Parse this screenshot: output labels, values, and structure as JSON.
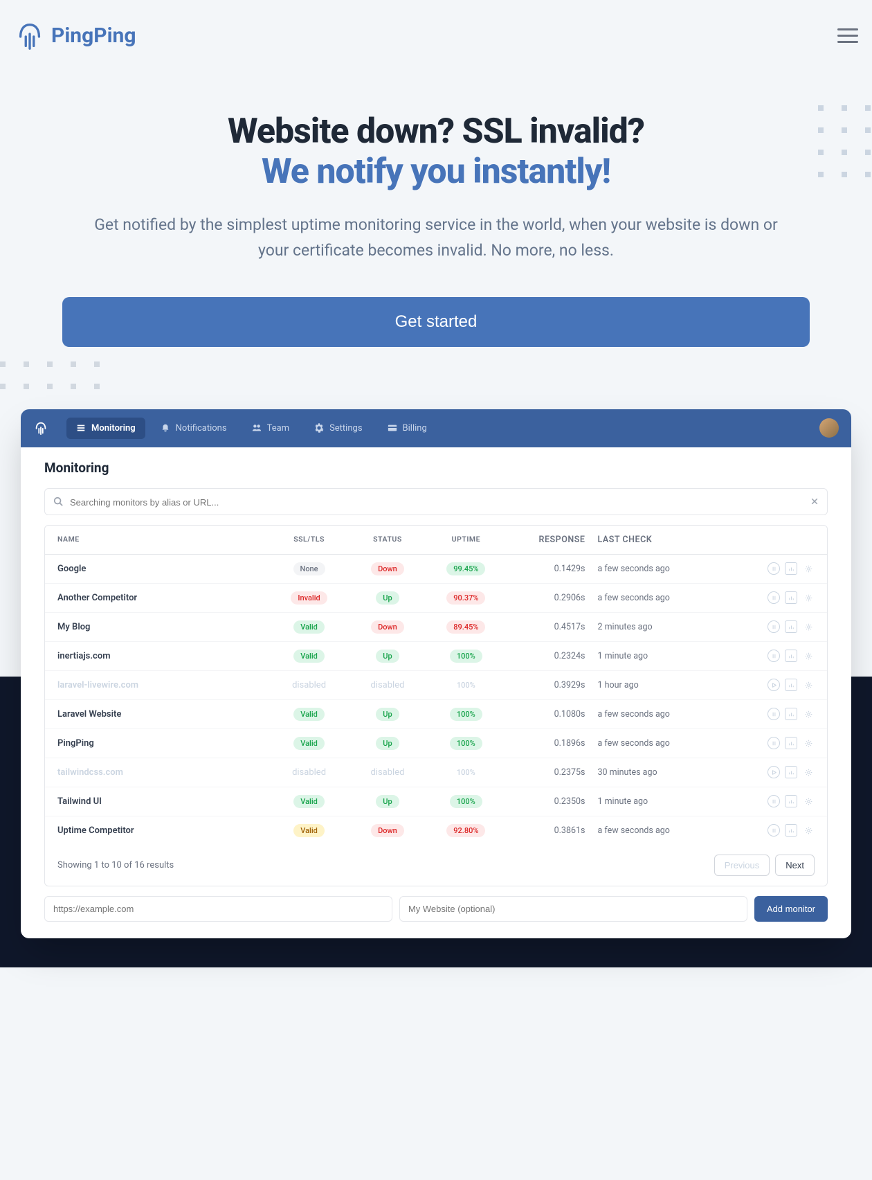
{
  "brand": "PingPing",
  "hero": {
    "line1": "Website down? SSL invalid?",
    "line2": "We notify you instantly!",
    "sub": "Get notified by the simplest uptime monitoring service in the world, when your website is down or your certificate becomes invalid. No more, no less.",
    "cta": "Get started"
  },
  "nav": {
    "monitoring": "Monitoring",
    "notifications": "Notifications",
    "team": "Team",
    "settings": "Settings",
    "billing": "Billing"
  },
  "app": {
    "title": "Monitoring",
    "search_placeholder": "Searching monitors by alias or URL...",
    "headers": {
      "name": "NAME",
      "ssl": "SSL/TLS",
      "status": "STATUS",
      "uptime": "UPTIME",
      "response": "RESPONSE",
      "last": "LAST CHECK"
    },
    "rows": [
      {
        "name": "Google",
        "ssl": "None",
        "ssl_c": "gray",
        "status": "Down",
        "status_c": "red",
        "uptime": "99.45%",
        "uptime_c": "green",
        "response": "0.1429s",
        "last": "a few seconds ago",
        "disabled": false,
        "paused": true
      },
      {
        "name": "Another Competitor",
        "ssl": "Invalid",
        "ssl_c": "red",
        "status": "Up",
        "status_c": "green",
        "uptime": "90.37%",
        "uptime_c": "red",
        "response": "0.2906s",
        "last": "a few seconds ago",
        "disabled": false,
        "paused": true
      },
      {
        "name": "My Blog",
        "ssl": "Valid",
        "ssl_c": "green",
        "status": "Down",
        "status_c": "red",
        "uptime": "89.45%",
        "uptime_c": "red",
        "response": "0.4517s",
        "last": "2 minutes ago",
        "disabled": false,
        "paused": true
      },
      {
        "name": "inertiajs.com",
        "ssl": "Valid",
        "ssl_c": "green",
        "status": "Up",
        "status_c": "green",
        "uptime": "100%",
        "uptime_c": "green",
        "response": "0.2324s",
        "last": "1 minute ago",
        "disabled": false,
        "paused": true
      },
      {
        "name": "laravel-livewire.com",
        "ssl": "disabled",
        "ssl_c": "",
        "status": "disabled",
        "status_c": "",
        "uptime": "100%",
        "uptime_c": "green",
        "response": "0.3929s",
        "last": "1 hour ago",
        "disabled": true,
        "paused": false
      },
      {
        "name": "Laravel Website",
        "ssl": "Valid",
        "ssl_c": "green",
        "status": "Up",
        "status_c": "green",
        "uptime": "100%",
        "uptime_c": "green",
        "response": "0.1080s",
        "last": "a few seconds ago",
        "disabled": false,
        "paused": true
      },
      {
        "name": "PingPing",
        "ssl": "Valid",
        "ssl_c": "green",
        "status": "Up",
        "status_c": "green",
        "uptime": "100%",
        "uptime_c": "green",
        "response": "0.1896s",
        "last": "a few seconds ago",
        "disabled": false,
        "paused": true
      },
      {
        "name": "tailwindcss.com",
        "ssl": "disabled",
        "ssl_c": "",
        "status": "disabled",
        "status_c": "",
        "uptime": "100%",
        "uptime_c": "green",
        "response": "0.2375s",
        "last": "30 minutes ago",
        "disabled": true,
        "paused": false
      },
      {
        "name": "Tailwind UI",
        "ssl": "Valid",
        "ssl_c": "green",
        "status": "Up",
        "status_c": "green",
        "uptime": "100%",
        "uptime_c": "green",
        "response": "0.2350s",
        "last": "1 minute ago",
        "disabled": false,
        "paused": true
      },
      {
        "name": "Uptime Competitor",
        "ssl": "Valid",
        "ssl_c": "yellow",
        "status": "Down",
        "status_c": "red",
        "uptime": "92.80%",
        "uptime_c": "red",
        "response": "0.3861s",
        "last": "a few seconds ago",
        "disabled": false,
        "paused": true
      }
    ],
    "footer_showing": "Showing 1 to 10 of 16 results",
    "prev": "Previous",
    "next": "Next",
    "url_placeholder": "https://example.com",
    "alias_placeholder": "My Website (optional)",
    "add_btn": "Add monitor"
  }
}
